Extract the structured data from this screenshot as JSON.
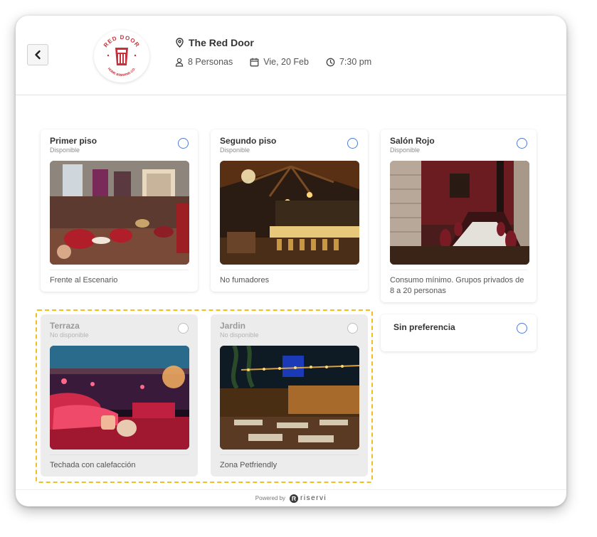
{
  "header": {
    "back_icon": "chevron-left-icon",
    "logo_text_top": "RED DOOR",
    "logo_text_bottom": "HOME BREWING CO.",
    "restaurant_name": "The Red Door",
    "party_size": "8 Personas",
    "date": "Vie, 20 Feb",
    "time": "7:30 pm"
  },
  "areas": [
    {
      "title": "Primer piso",
      "status": "Disponible",
      "description": "Frente al Escenario",
      "available": true
    },
    {
      "title": "Segundo piso",
      "status": "Disponible",
      "description": "No fumadores",
      "available": true
    },
    {
      "title": "Salón Rojo",
      "status": "Disponible",
      "description": "Consumo mínimo. Grupos privados de 8 a 20 personas",
      "available": true
    },
    {
      "title": "Terraza",
      "status": "No disponible",
      "description": "Techada con calefacción",
      "available": false
    },
    {
      "title": "Jardin",
      "status": "No disponible",
      "description": "Zona Petfriendly",
      "available": false
    }
  ],
  "no_preference": {
    "title": "Sin preferencia"
  },
  "footer": {
    "powered_by": "Powered by",
    "brand": "riservi"
  },
  "colors": {
    "radio": "#4c7dd3",
    "highlight": "#f0c020",
    "logo_red": "#c8313a"
  }
}
